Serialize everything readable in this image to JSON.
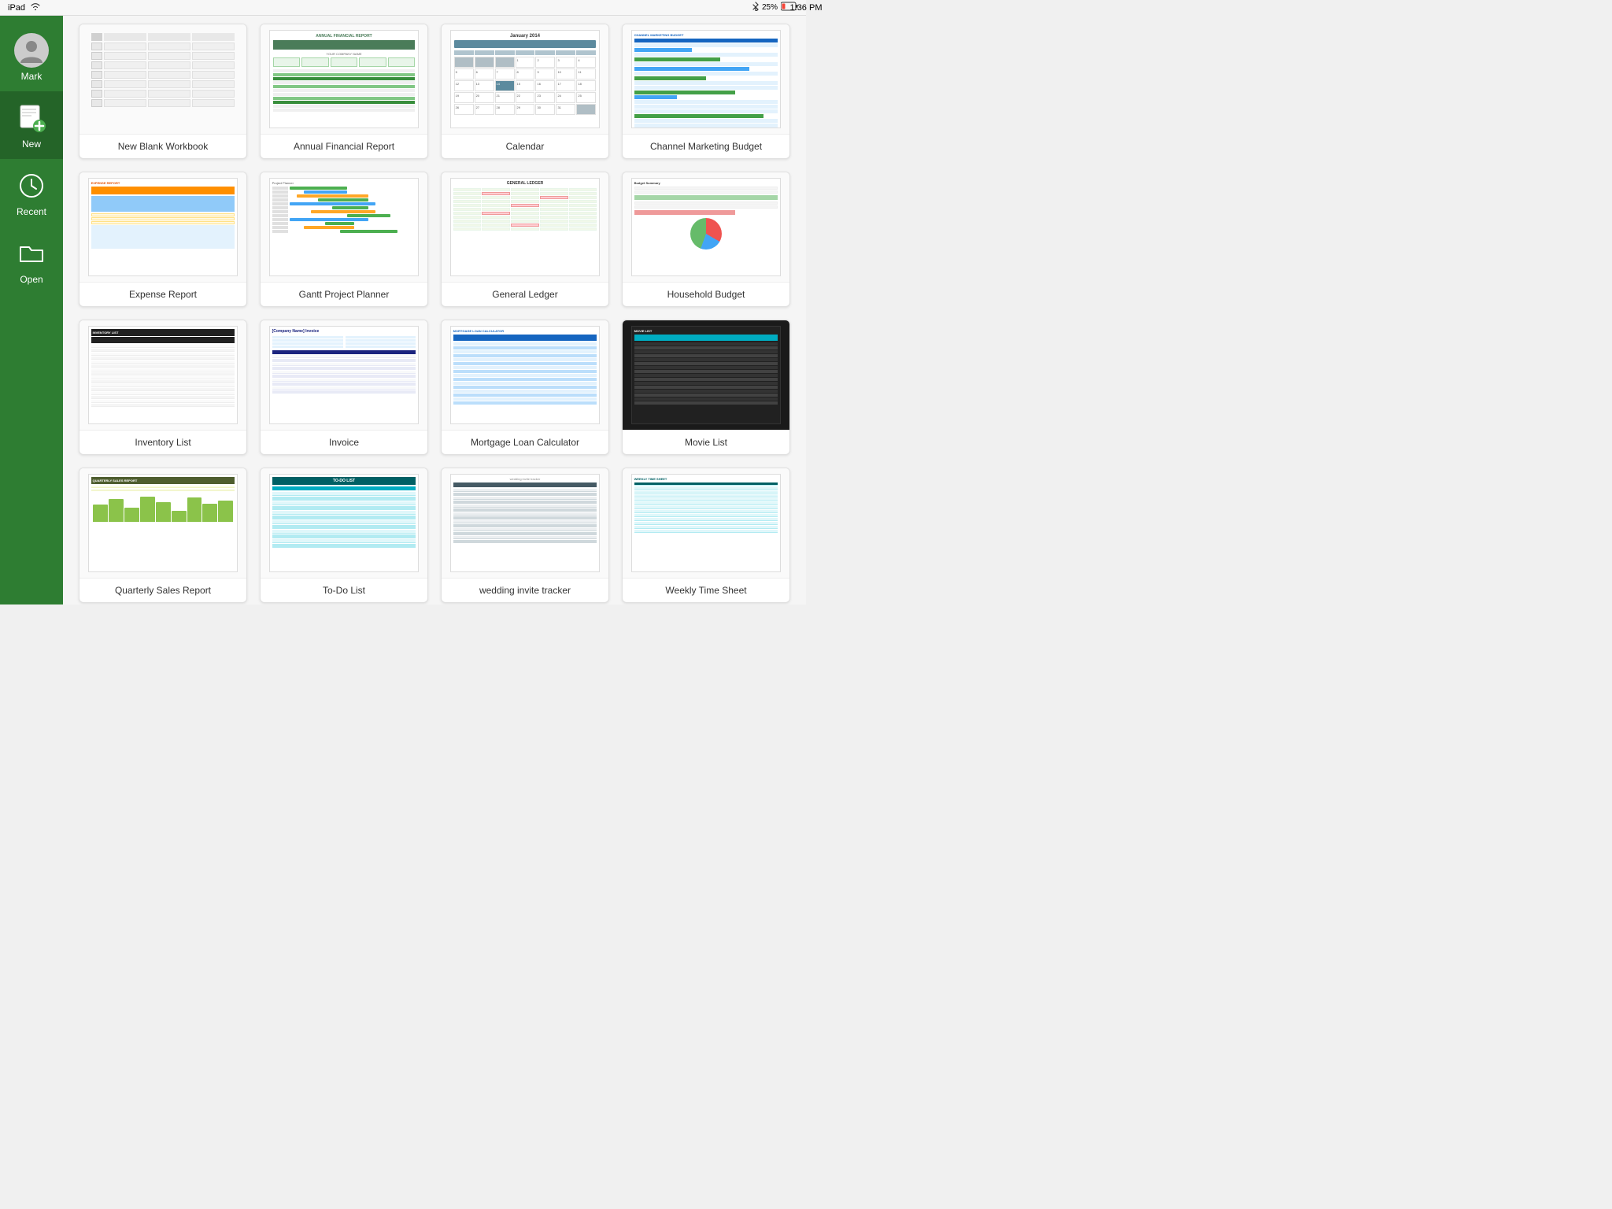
{
  "statusBar": {
    "device": "iPad",
    "wifi": "wifi",
    "time": "1:36 PM",
    "bluetooth": "bluetooth",
    "battery": "25%"
  },
  "sidebar": {
    "user": {
      "name": "Mark",
      "label": "Mark"
    },
    "items": [
      {
        "id": "new",
        "label": "New",
        "icon": "new-icon"
      },
      {
        "id": "recent",
        "label": "Recent",
        "icon": "clock-icon"
      },
      {
        "id": "open",
        "label": "Open",
        "icon": "folder-icon"
      }
    ]
  },
  "templates": [
    {
      "id": "blank",
      "label": "New Blank Workbook"
    },
    {
      "id": "annual-financial",
      "label": "Annual Financial Report"
    },
    {
      "id": "calendar",
      "label": "Calendar"
    },
    {
      "id": "channel-marketing",
      "label": "Channel Marketing Budget"
    },
    {
      "id": "expense-report",
      "label": "Expense Report"
    },
    {
      "id": "gantt",
      "label": "Gantt Project Planner"
    },
    {
      "id": "general-ledger",
      "label": "General Ledger"
    },
    {
      "id": "household-budget",
      "label": "Household Budget"
    },
    {
      "id": "inventory-list",
      "label": "Inventory List"
    },
    {
      "id": "invoice",
      "label": "Invoice"
    },
    {
      "id": "mortgage",
      "label": "Mortgage Loan Calculator"
    },
    {
      "id": "movie-list",
      "label": "Movie List"
    },
    {
      "id": "quarterly-sales",
      "label": "Quarterly Sales Report"
    },
    {
      "id": "todo",
      "label": "To-Do List"
    },
    {
      "id": "wedding",
      "label": "wedding invite tracker"
    },
    {
      "id": "weekly-timesheet",
      "label": "Weekly Time Sheet"
    }
  ]
}
